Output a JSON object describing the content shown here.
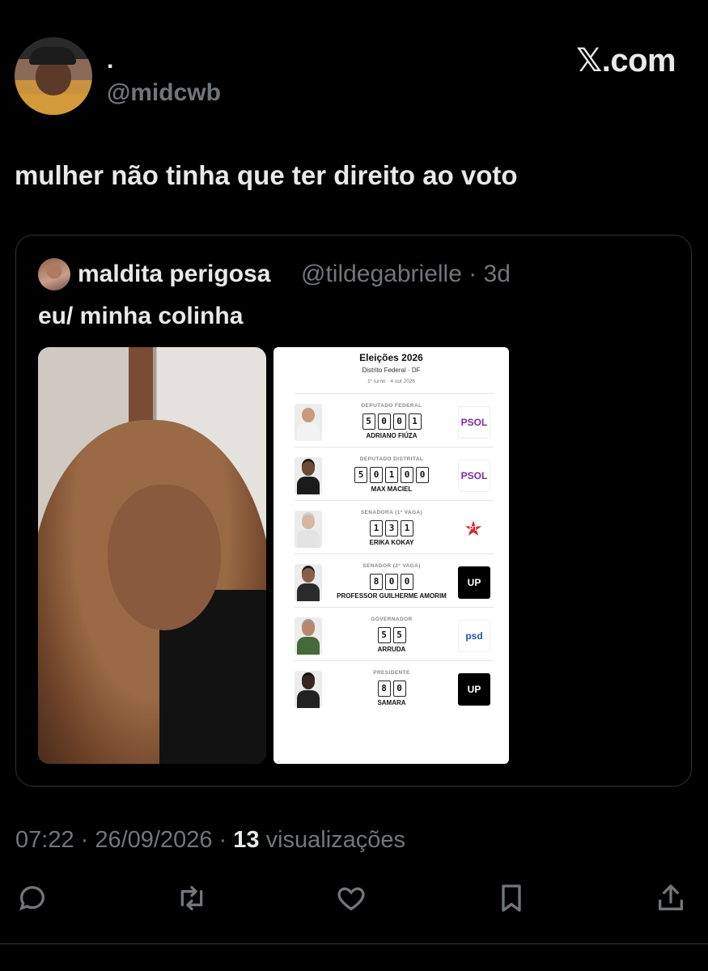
{
  "header": {
    "display_name": ".",
    "handle": "@midcwb",
    "brand": "𝕏.com"
  },
  "tweet": {
    "text": "mulher não tinha que ter direito ao voto"
  },
  "quote": {
    "name": "maldita perigosa",
    "handle_time": "@tildegabrielle · 3d",
    "text": "eu/ minha colinha",
    "ballot": {
      "title": "Eleições 2026",
      "subtitle": "Distrito Federal · DF",
      "subtitle2": "1º turno · 4 out 2026",
      "candidates": [
        {
          "role": "DEPUTADO FEDERAL",
          "digits": [
            "5",
            "0",
            "0",
            "1"
          ],
          "name": "ADRIANO FIÚZA",
          "party": "PSOL",
          "party_color": "#7b2d9e",
          "party_icon": "psol-sun-logo"
        },
        {
          "role": "DEPUTADO DISTRITAL",
          "digits": [
            "5",
            "0",
            "1",
            "0",
            "0"
          ],
          "name": "MAX MACIEL",
          "party": "PSOL",
          "party_color": "#7b2d9e",
          "party_icon": "psol-sun-logo"
        },
        {
          "role": "SENADORA (1ª VAGA)",
          "digits": [
            "1",
            "3",
            "1"
          ],
          "name": "ERIKA KOKAY",
          "party": "PT",
          "party_color": "#d8262c",
          "party_icon": "pt-star-logo"
        },
        {
          "role": "SENADOR (2ª VAGA)",
          "digits": [
            "8",
            "0",
            "0"
          ],
          "name": "PROFESSOR GUILHERME AMORIM",
          "party": "UP",
          "party_color": "#000000",
          "party_icon": "up-fist-logo"
        },
        {
          "role": "GOVERNADOR",
          "digits": [
            "5",
            "5"
          ],
          "name": "ARRUDA",
          "party": "psd",
          "party_color": "#1e5aa8",
          "party_icon": "psd-logo"
        },
        {
          "role": "PRESIDENTE",
          "digits": [
            "8",
            "0"
          ],
          "name": "SAMARA",
          "party": "UP",
          "party_color": "#000000",
          "party_icon": "up-fist-logo"
        }
      ]
    }
  },
  "meta": {
    "time_date": "07:22 · 26/09/2026 · ",
    "views_count": "13",
    "views_label": " visualizações"
  },
  "actions": [
    {
      "name": "reply-icon"
    },
    {
      "name": "retweet-icon"
    },
    {
      "name": "like-icon"
    },
    {
      "name": "bookmark-icon"
    },
    {
      "name": "share-icon"
    }
  ]
}
